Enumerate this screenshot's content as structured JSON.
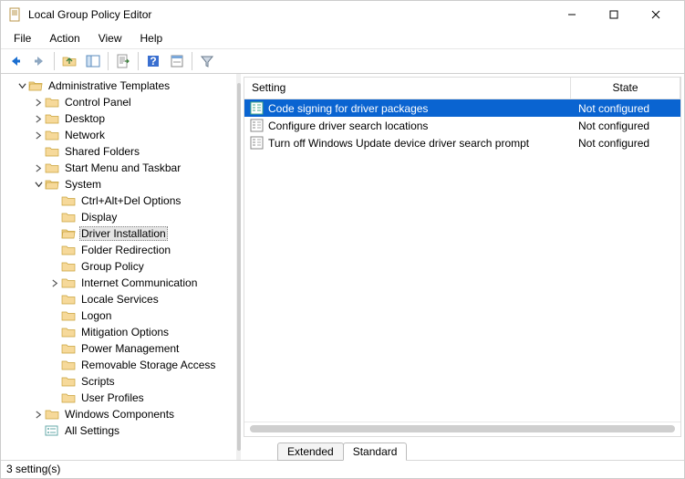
{
  "window": {
    "title": "Local Group Policy Editor"
  },
  "menu": {
    "file": "File",
    "action": "Action",
    "view": "View",
    "help": "Help"
  },
  "tree": {
    "root": "Administrative Templates",
    "control_panel": "Control Panel",
    "desktop": "Desktop",
    "network": "Network",
    "shared_folders": "Shared Folders",
    "start_menu": "Start Menu and Taskbar",
    "system": "System",
    "system_children": {
      "ctrl_alt_del": "Ctrl+Alt+Del Options",
      "display": "Display",
      "driver_installation": "Driver Installation",
      "folder_redirection": "Folder Redirection",
      "group_policy": "Group Policy",
      "internet_comm": "Internet Communication",
      "locale_services": "Locale Services",
      "logon": "Logon",
      "mitigation_options": "Mitigation Options",
      "power_management": "Power Management",
      "removable_storage": "Removable Storage Access",
      "scripts": "Scripts",
      "user_profiles": "User Profiles"
    },
    "windows_components": "Windows Components",
    "all_settings": "All Settings"
  },
  "list": {
    "header_setting": "Setting",
    "header_state": "State",
    "rows": [
      {
        "name": "Code signing for driver packages",
        "state": "Not configured"
      },
      {
        "name": "Configure driver search locations",
        "state": "Not configured"
      },
      {
        "name": "Turn off Windows Update device driver search prompt",
        "state": "Not configured"
      }
    ]
  },
  "tabs": {
    "extended": "Extended",
    "standard": "Standard"
  },
  "status": "3 setting(s)"
}
